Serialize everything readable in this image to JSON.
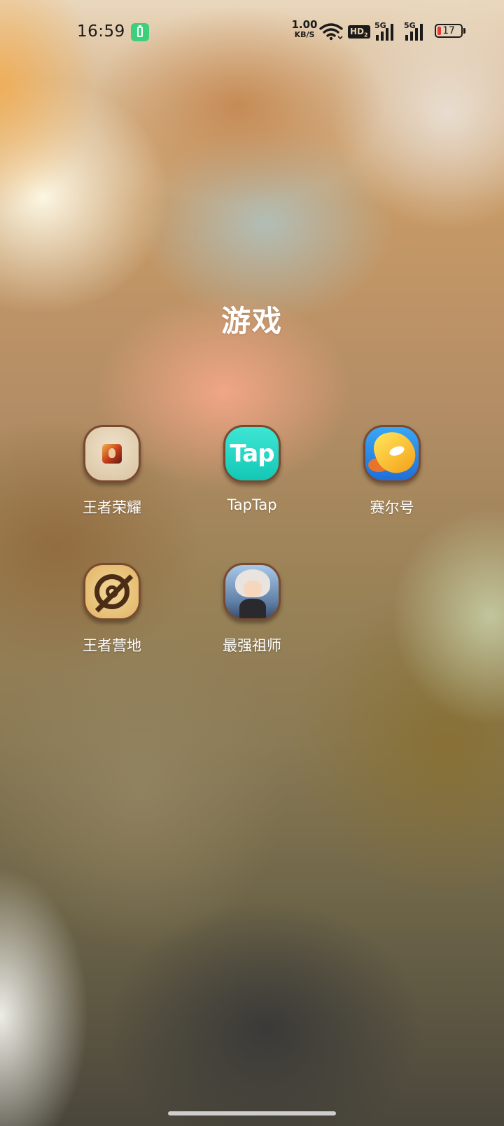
{
  "status_bar": {
    "time": "16:59",
    "net_speed_value": "1.00",
    "net_speed_unit": "KB/S",
    "hd_label": "HD",
    "hd_sub": "2",
    "sim1_label": "5G",
    "sim2_label": "5G",
    "battery_level": "17",
    "battery_fraction": 0.17,
    "charge_badge_color": "#3ccf7c",
    "battery_low_color": "#e53935"
  },
  "folder": {
    "title": "游戏",
    "apps": [
      {
        "label": "王者荣耀",
        "icon": "honor-of-kings-icon"
      },
      {
        "label": "TapTap",
        "icon": "taptap-icon",
        "icon_text": "Tap"
      },
      {
        "label": "赛尔号",
        "icon": "seer-icon"
      },
      {
        "label": "王者营地",
        "icon": "kings-camp-icon"
      },
      {
        "label": "最强祖师",
        "icon": "strongest-patriarch-icon"
      }
    ]
  }
}
